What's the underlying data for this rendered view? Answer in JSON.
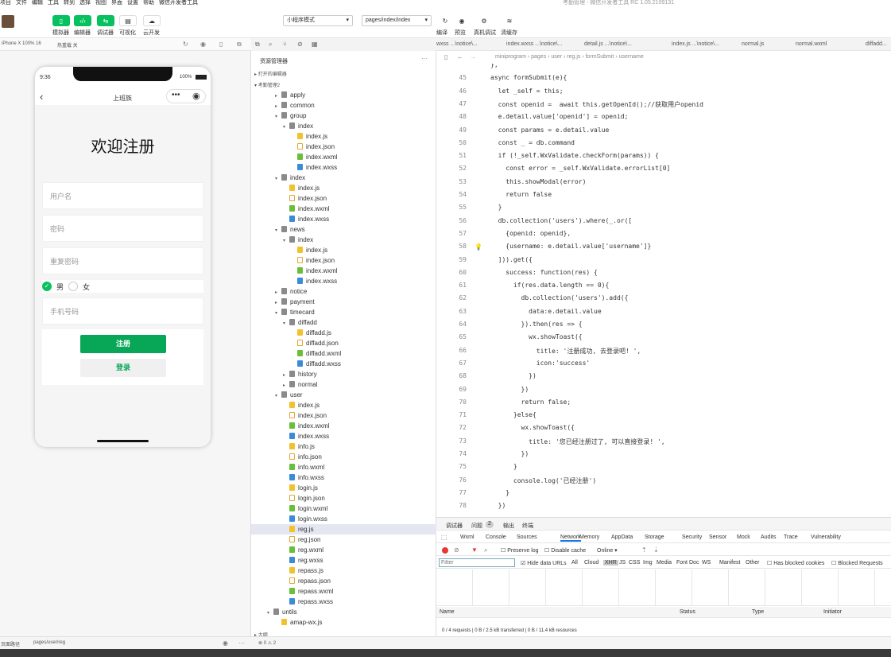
{
  "menu": [
    "项目",
    "文件",
    "编辑",
    "工具",
    "转到",
    "选择",
    "视图",
    "界面",
    "设置",
    "帮助",
    "微信开发者工具"
  ],
  "window_title": "考勤管理 - 微信开发者工具 RC 1.05.2109131",
  "toolbar": {
    "buttons": [
      "模拟器",
      "编辑器",
      "调试器",
      "可视化",
      "云开发"
    ],
    "mode": "小程序模式",
    "page": "pages/index/index",
    "actions": [
      "编译",
      "预览",
      "真机调试",
      "清缓存"
    ]
  },
  "simulator": {
    "device": "iPhone X 100% 16",
    "hot": "热重载 关",
    "time": "9:36",
    "battery": "100%",
    "nav_title": "上班族",
    "page_title": "欢迎注册",
    "fields": [
      "用户名",
      "密码",
      "重复密码"
    ],
    "gender_male": "男",
    "gender_female": "女",
    "phone_placeholder": "手机号码",
    "register_btn": "注册",
    "login_btn": "登录"
  },
  "explorer": {
    "title": "资源管理器",
    "open_editors": "打开的编辑器",
    "project": "考勤管理2",
    "outline": "大纲",
    "problems": "0 ⚠ 2",
    "items": [
      {
        "d": 1,
        "t": "folder",
        "n": "apply",
        "a": "▸"
      },
      {
        "d": 1,
        "t": "folder",
        "n": "common",
        "a": "▸"
      },
      {
        "d": 1,
        "t": "folder",
        "n": "group",
        "a": "▾"
      },
      {
        "d": 2,
        "t": "folder",
        "n": "index",
        "a": "▾"
      },
      {
        "d": 3,
        "t": "js",
        "n": "index.js"
      },
      {
        "d": 3,
        "t": "json",
        "n": "index.json"
      },
      {
        "d": 3,
        "t": "wxml",
        "n": "index.wxml"
      },
      {
        "d": 3,
        "t": "wxss",
        "n": "index.wxss"
      },
      {
        "d": 1,
        "t": "folder",
        "n": "index",
        "a": "▾"
      },
      {
        "d": 2,
        "t": "js",
        "n": "index.js"
      },
      {
        "d": 2,
        "t": "json",
        "n": "index.json"
      },
      {
        "d": 2,
        "t": "wxml",
        "n": "index.wxml"
      },
      {
        "d": 2,
        "t": "wxss",
        "n": "index.wxss"
      },
      {
        "d": 1,
        "t": "folder",
        "n": "news",
        "a": "▾"
      },
      {
        "d": 2,
        "t": "folder",
        "n": "index",
        "a": "▾"
      },
      {
        "d": 3,
        "t": "js",
        "n": "index.js"
      },
      {
        "d": 3,
        "t": "json",
        "n": "index.json"
      },
      {
        "d": 3,
        "t": "wxml",
        "n": "index.wxml"
      },
      {
        "d": 3,
        "t": "wxss",
        "n": "index.wxss"
      },
      {
        "d": 1,
        "t": "folder",
        "n": "notice",
        "a": "▸"
      },
      {
        "d": 1,
        "t": "folder",
        "n": "payment",
        "a": "▸"
      },
      {
        "d": 1,
        "t": "folder",
        "n": "timecard",
        "a": "▾"
      },
      {
        "d": 2,
        "t": "folder",
        "n": "diffadd",
        "a": "▾"
      },
      {
        "d": 3,
        "t": "js",
        "n": "diffadd.js"
      },
      {
        "d": 3,
        "t": "json",
        "n": "diffadd.json"
      },
      {
        "d": 3,
        "t": "wxml",
        "n": "diffadd.wxml"
      },
      {
        "d": 3,
        "t": "wxss",
        "n": "diffadd.wxss"
      },
      {
        "d": 2,
        "t": "folder",
        "n": "history",
        "a": "▸"
      },
      {
        "d": 2,
        "t": "folder",
        "n": "normal",
        "a": "▸"
      },
      {
        "d": 1,
        "t": "folder",
        "n": "user",
        "a": "▾"
      },
      {
        "d": 2,
        "t": "js",
        "n": "index.js"
      },
      {
        "d": 2,
        "t": "json",
        "n": "index.json"
      },
      {
        "d": 2,
        "t": "wxml",
        "n": "index.wxml"
      },
      {
        "d": 2,
        "t": "wxss",
        "n": "index.wxss"
      },
      {
        "d": 2,
        "t": "js",
        "n": "info.js"
      },
      {
        "d": 2,
        "t": "json",
        "n": "info.json"
      },
      {
        "d": 2,
        "t": "wxml",
        "n": "info.wxml"
      },
      {
        "d": 2,
        "t": "wxss",
        "n": "info.wxss"
      },
      {
        "d": 2,
        "t": "js",
        "n": "login.js"
      },
      {
        "d": 2,
        "t": "json",
        "n": "login.json"
      },
      {
        "d": 2,
        "t": "wxml",
        "n": "login.wxml"
      },
      {
        "d": 2,
        "t": "wxss",
        "n": "login.wxss"
      },
      {
        "d": 2,
        "t": "js",
        "n": "reg.js",
        "sel": true
      },
      {
        "d": 2,
        "t": "json",
        "n": "reg.json"
      },
      {
        "d": 2,
        "t": "wxml",
        "n": "reg.wxml"
      },
      {
        "d": 2,
        "t": "wxss",
        "n": "reg.wxss"
      },
      {
        "d": 2,
        "t": "js",
        "n": "repass.js"
      },
      {
        "d": 2,
        "t": "json",
        "n": "repass.json"
      },
      {
        "d": 2,
        "t": "wxml",
        "n": "repass.wxml"
      },
      {
        "d": 2,
        "t": "wxss",
        "n": "repass.wxss"
      },
      {
        "d": 0,
        "t": "folder",
        "n": "untils",
        "a": "▾"
      },
      {
        "d": 1,
        "t": "js",
        "n": "amap-wx.js"
      }
    ]
  },
  "tabs": [
    "wxss ...\\notice\\...",
    "index.wxss ...\\notice\\...",
    "detail.js ...\\notice\\...",
    "index.js ...\\notice\\...",
    "normal.js",
    "normal.wxml",
    "diffadd..."
  ],
  "breadcrumb": "miniprogram › pages › user › reg.js › formSubmit › username",
  "code": [
    {
      "n": "",
      "c": "},"
    },
    {
      "n": "45",
      "c": "async formSubmit(e){"
    },
    {
      "n": "46",
      "c": "  let _self = this;"
    },
    {
      "n": "47",
      "c": "  const openid =  await this.getOpenId();//获取用户openid"
    },
    {
      "n": "48",
      "c": "  e.detail.value['openid'] = openid;"
    },
    {
      "n": "49",
      "c": "  const params = e.detail.value"
    },
    {
      "n": "50",
      "c": "  const _ = db.command"
    },
    {
      "n": "51",
      "c": "  if (!_self.WxValidate.checkForm(params)) {"
    },
    {
      "n": "52",
      "c": "    const error = _self.WxValidate.errorList[0]"
    },
    {
      "n": "53",
      "c": "    this.showModal(error)"
    },
    {
      "n": "54",
      "c": "    return false"
    },
    {
      "n": "55",
      "c": "  }"
    },
    {
      "n": "56",
      "c": "  db.collection('users').where(_.or(["
    },
    {
      "n": "57",
      "c": "    {openid: openid},"
    },
    {
      "n": "58",
      "c": "    {username: e.detail.value['username']}"
    },
    {
      "n": "59",
      "c": "  ])).get({"
    },
    {
      "n": "60",
      "c": "    success: function(res) {"
    },
    {
      "n": "61",
      "c": "      if(res.data.length == 0){"
    },
    {
      "n": "62",
      "c": "        db.collection('users').add({"
    },
    {
      "n": "63",
      "c": "          data:e.detail.value"
    },
    {
      "n": "64",
      "c": "        }).then(res => {"
    },
    {
      "n": "65",
      "c": "          wx.showToast({"
    },
    {
      "n": "66",
      "c": "            title: '注册成功, 去登录吧! ',"
    },
    {
      "n": "67",
      "c": "            icon:'success'"
    },
    {
      "n": "68",
      "c": "          })"
    },
    {
      "n": "69",
      "c": "        })"
    },
    {
      "n": "70",
      "c": "        return false;"
    },
    {
      "n": "71",
      "c": "      }else{"
    },
    {
      "n": "72",
      "c": "        wx.showToast({"
    },
    {
      "n": "73",
      "c": "          title: '您已经注册过了, 可以直接登录! ',"
    },
    {
      "n": "74",
      "c": "        })"
    },
    {
      "n": "75",
      "c": "      }"
    },
    {
      "n": "76",
      "c": "      console.log('已经注册')"
    },
    {
      "n": "77",
      "c": "    }"
    },
    {
      "n": "78",
      "c": "  })"
    }
  ],
  "devtools": {
    "panels": [
      "调试器",
      "问题",
      "2",
      "输出",
      "终端"
    ],
    "tabs": [
      "Wxml",
      "Console",
      "Sources",
      "Network",
      "Memory",
      "AppData",
      "Storage",
      "Security",
      "Sensor",
      "Mock",
      "Audits",
      "Trace",
      "Vulnerability"
    ],
    "preserve": "Preserve log",
    "disable_cache": "Disable cache",
    "online": "Online",
    "filter_placeholder": "Filter",
    "hide_urls": "Hide data URLs",
    "types": [
      "All",
      "Cloud",
      "XHR",
      "JS",
      "CSS",
      "Img",
      "Media",
      "Font",
      "Doc",
      "WS",
      "Manifest",
      "Other"
    ],
    "blocked_cookies": "Has blocked cookies",
    "blocked_req": "Blocked Requests",
    "columns": [
      "Name",
      "Status",
      "Type",
      "Initiator"
    ],
    "summary": "0 / 4 requests  |  0 B / 2.5 kB transferred  |  0 B / 11.4 kB resources"
  },
  "status": {
    "path_label": "页面路径",
    "path": "pages/user/reg"
  }
}
